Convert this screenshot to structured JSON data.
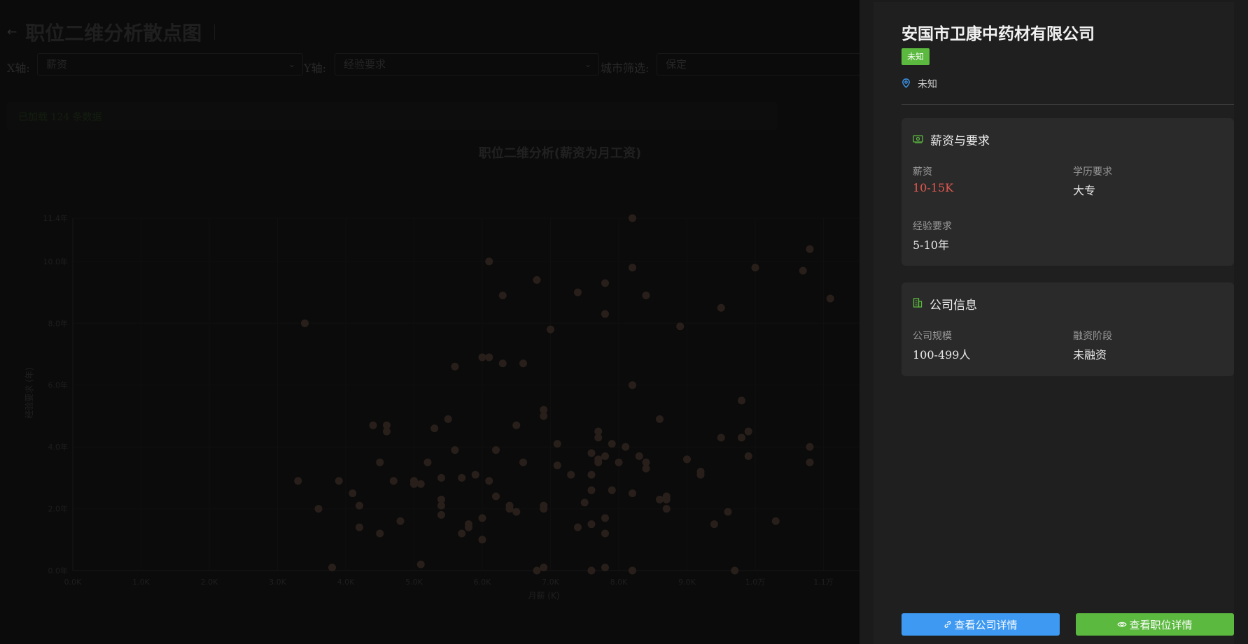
{
  "page": {
    "title": "职位二维分析散点图",
    "back_icon": "arrow-left-icon"
  },
  "filters": {
    "x_label": "X轴:",
    "x_value": "薪资",
    "y_label": "Y轴:",
    "y_value": "经验要求",
    "city_label": "城市筛选:",
    "city_value": "保定"
  },
  "status": {
    "loaded_text": "已加载 124 条数据"
  },
  "chart_data": {
    "type": "scatter",
    "title": "职位二维分析(薪资为月工资)",
    "xlabel": "月薪 (K)",
    "ylabel": "经验要求 (年)",
    "x_ticks": [
      "0.0K",
      "1.0K",
      "2.0K",
      "3.0K",
      "4.0K",
      "5.0K",
      "6.0K",
      "7.0K",
      "8.0K",
      "9.0K",
      "1.0万",
      "1.1万"
    ],
    "y_ticks": [
      "0.0年",
      "2.0年",
      "4.0年",
      "6.0年",
      "8.0年",
      "10.0年",
      "11.4年"
    ],
    "xlim": [
      0,
      11.5
    ],
    "ylim": [
      0,
      11.4
    ],
    "grid": true,
    "point_color": "#4a3a32",
    "points": [
      [
        3.3,
        2.9
      ],
      [
        3.4,
        8.0
      ],
      [
        3.6,
        2.0
      ],
      [
        3.8,
        0.1
      ],
      [
        3.9,
        2.9
      ],
      [
        4.1,
        2.5
      ],
      [
        4.2,
        2.1
      ],
      [
        4.2,
        1.4
      ],
      [
        4.4,
        4.7
      ],
      [
        4.5,
        3.5
      ],
      [
        4.5,
        1.2
      ],
      [
        4.6,
        4.7
      ],
      [
        4.6,
        4.5
      ],
      [
        4.7,
        2.9
      ],
      [
        4.8,
        1.6
      ],
      [
        5.0,
        2.8
      ],
      [
        5.0,
        2.9
      ],
      [
        5.1,
        2.8
      ],
      [
        5.1,
        0.2
      ],
      [
        5.2,
        3.5
      ],
      [
        5.3,
        4.6
      ],
      [
        5.4,
        3.0
      ],
      [
        5.4,
        2.3
      ],
      [
        5.4,
        2.1
      ],
      [
        5.4,
        1.8
      ],
      [
        5.5,
        4.9
      ],
      [
        5.6,
        6.6
      ],
      [
        5.6,
        3.9
      ],
      [
        5.7,
        3.0
      ],
      [
        5.7,
        1.2
      ],
      [
        5.8,
        1.5
      ],
      [
        5.8,
        1.4
      ],
      [
        5.9,
        3.1
      ],
      [
        6.0,
        6.9
      ],
      [
        6.0,
        1.7
      ],
      [
        6.0,
        1.0
      ],
      [
        6.1,
        10.0
      ],
      [
        6.1,
        6.9
      ],
      [
        6.1,
        2.9
      ],
      [
        6.2,
        3.9
      ],
      [
        6.2,
        2.4
      ],
      [
        6.3,
        8.9
      ],
      [
        6.3,
        6.7
      ],
      [
        6.4,
        2.1
      ],
      [
        6.4,
        2.0
      ],
      [
        6.5,
        4.7
      ],
      [
        6.5,
        1.9
      ],
      [
        6.6,
        6.7
      ],
      [
        6.6,
        3.5
      ],
      [
        6.8,
        9.4
      ],
      [
        6.8,
        0.0
      ],
      [
        6.9,
        5.2
      ],
      [
        6.9,
        5.0
      ],
      [
        6.9,
        2.1
      ],
      [
        6.9,
        2.0
      ],
      [
        6.9,
        0.1
      ],
      [
        7.0,
        7.8
      ],
      [
        7.1,
        4.1
      ],
      [
        7.1,
        3.4
      ],
      [
        7.3,
        3.1
      ],
      [
        7.4,
        9.0
      ],
      [
        7.4,
        1.4
      ],
      [
        7.5,
        2.2
      ],
      [
        7.6,
        3.8
      ],
      [
        7.6,
        3.1
      ],
      [
        7.6,
        2.6
      ],
      [
        7.6,
        1.5
      ],
      [
        7.6,
        0.0
      ],
      [
        7.7,
        4.5
      ],
      [
        7.7,
        4.3
      ],
      [
        7.7,
        3.6
      ],
      [
        7.7,
        3.5
      ],
      [
        7.8,
        9.3
      ],
      [
        7.8,
        8.3
      ],
      [
        7.8,
        3.7
      ],
      [
        7.8,
        1.7
      ],
      [
        7.8,
        1.2
      ],
      [
        7.8,
        0.1
      ],
      [
        7.9,
        4.1
      ],
      [
        7.9,
        2.6
      ],
      [
        8.0,
        3.5
      ],
      [
        8.1,
        4.0
      ],
      [
        8.2,
        11.4
      ],
      [
        8.2,
        9.8
      ],
      [
        8.2,
        6.0
      ],
      [
        8.2,
        2.5
      ],
      [
        8.2,
        0.0
      ],
      [
        8.3,
        3.7
      ],
      [
        8.4,
        8.9
      ],
      [
        8.4,
        3.5
      ],
      [
        8.4,
        3.3
      ],
      [
        8.6,
        4.9
      ],
      [
        8.6,
        2.3
      ],
      [
        8.7,
        2.4
      ],
      [
        8.7,
        2.3
      ],
      [
        8.7,
        2.0
      ],
      [
        8.9,
        7.9
      ],
      [
        9.0,
        3.6
      ],
      [
        9.2,
        3.2
      ],
      [
        9.2,
        3.1
      ],
      [
        9.4,
        1.5
      ],
      [
        9.5,
        8.5
      ],
      [
        9.5,
        4.3
      ],
      [
        9.6,
        1.9
      ],
      [
        9.7,
        0.0
      ],
      [
        9.8,
        5.5
      ],
      [
        9.8,
        4.3
      ],
      [
        9.9,
        4.5
      ],
      [
        9.9,
        3.7
      ],
      [
        10.0,
        9.8
      ],
      [
        10.3,
        1.6
      ],
      [
        10.7,
        9.7
      ],
      [
        10.8,
        10.4
      ],
      [
        10.8,
        4.0
      ],
      [
        10.8,
        3.5
      ],
      [
        11.1,
        8.8
      ]
    ]
  },
  "drawer": {
    "company_name": "安国市卫康中药材有限公司",
    "status_tag": "未知",
    "location_icon": "map-pin-icon",
    "location": "未知",
    "salary_section": {
      "icon": "money-icon",
      "title": "薪资与要求",
      "salary_label": "薪资",
      "salary_value": "10-15K",
      "education_label": "学历要求",
      "education_value": "大专",
      "experience_label": "经验要求",
      "experience_value": "5-10年"
    },
    "company_section": {
      "icon": "building-icon",
      "title": "公司信息",
      "scale_label": "公司规模",
      "scale_value": "100-499人",
      "funding_label": "融资阶段",
      "funding_value": "未融资"
    },
    "btn_company_label": "查看公司详情",
    "btn_company_icon": "link-icon",
    "btn_job_label": "查看职位详情",
    "btn_job_icon": "eye-icon",
    "colors": {
      "accent_green": "#5bb93f",
      "accent_blue": "#3d99f2",
      "salary_red": "#e0574e"
    }
  }
}
